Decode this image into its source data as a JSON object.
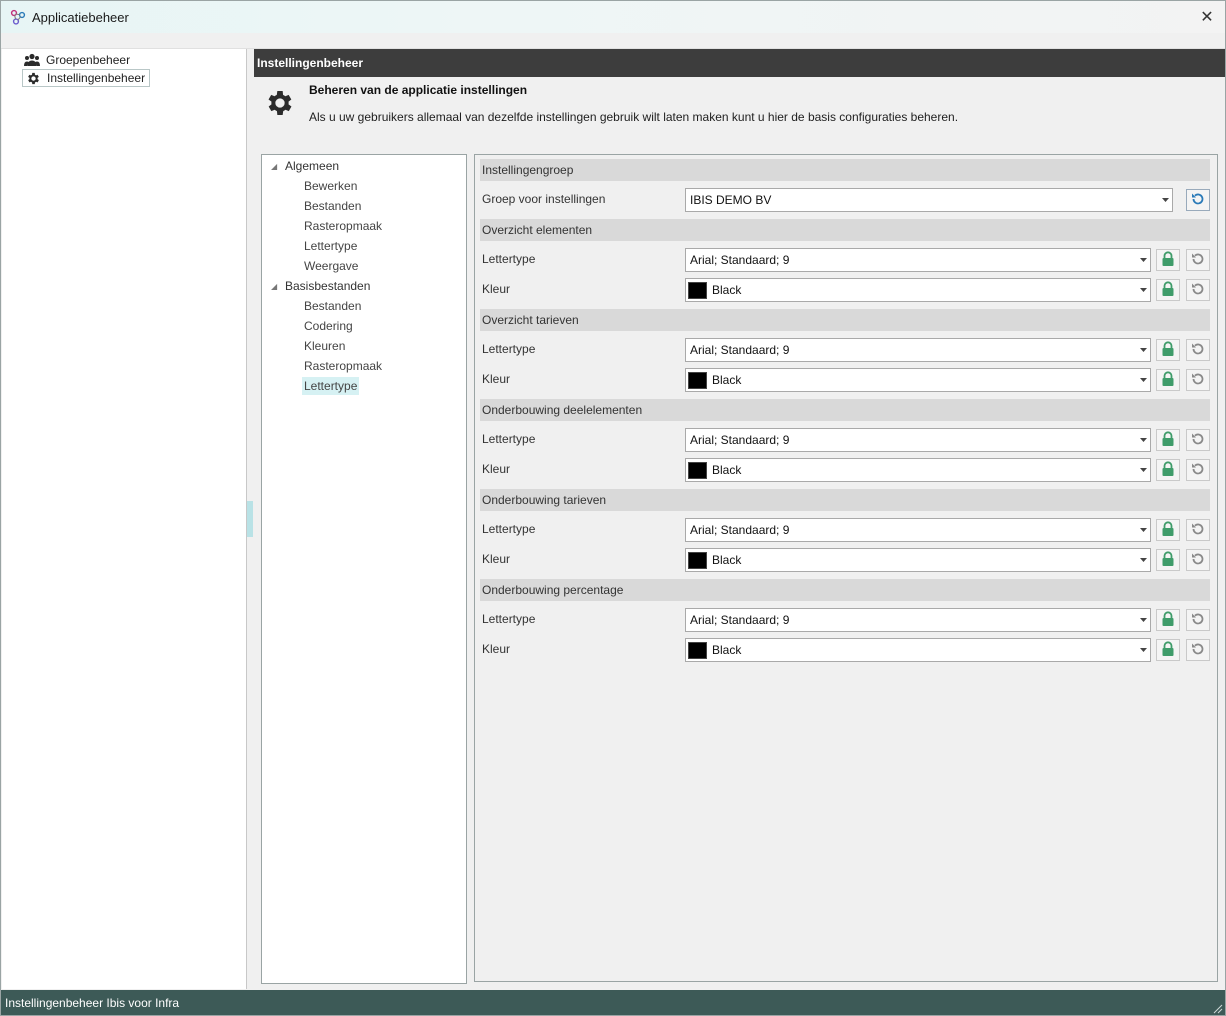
{
  "window": {
    "title": "Applicatiebeheer",
    "close_label": "✕"
  },
  "nav": {
    "items": [
      {
        "label": "Groepenbeheer",
        "icon": "users-icon"
      },
      {
        "label": "Instellingenbeheer",
        "icon": "gear-icon",
        "selected": true
      }
    ]
  },
  "panel": {
    "header": "Instellingenbeheer",
    "desc_title": "Beheren van de applicatie instellingen",
    "desc_text": "Als u uw gebruikers allemaal van dezelfde instellingen gebruik wilt laten maken kunt u hier de basis configuraties beheren."
  },
  "tree": {
    "groups": [
      {
        "label": "Algemeen",
        "children": [
          "Bewerken",
          "Bestanden",
          "Rasteropmaak",
          "Lettertype",
          "Weergave"
        ]
      },
      {
        "label": "Basisbestanden",
        "children": [
          "Bestanden",
          "Codering",
          "Kleuren",
          "Rasteropmaak",
          "Lettertype"
        ]
      }
    ],
    "selected": "Basisbestanden/Lettertype"
  },
  "settings": {
    "group_header": "Instellingengroep",
    "group_label": "Groep voor instellingen",
    "group_value": "IBIS DEMO BV",
    "sections": [
      {
        "title": "Overzicht elementen",
        "font_label": "Lettertype",
        "font_value": "Arial; Standaard; 9",
        "color_label": "Kleur",
        "color_value": "Black"
      },
      {
        "title": "Overzicht tarieven",
        "font_label": "Lettertype",
        "font_value": "Arial; Standaard; 9",
        "color_label": "Kleur",
        "color_value": "Black"
      },
      {
        "title": "Onderbouwing deelelementen",
        "font_label": "Lettertype",
        "font_value": "Arial; Standaard; 9",
        "color_label": "Kleur",
        "color_value": "Black"
      },
      {
        "title": "Onderbouwing tarieven",
        "font_label": "Lettertype",
        "font_value": "Arial; Standaard; 9",
        "color_label": "Kleur",
        "color_value": "Black"
      },
      {
        "title": "Onderbouwing percentage",
        "font_label": "Lettertype",
        "font_value": "Arial; Standaard; 9",
        "color_label": "Kleur",
        "color_value": "Black"
      }
    ]
  },
  "status": {
    "text": "Instellingenbeheer Ibis voor Infra"
  },
  "colors": {
    "header_bg": "#3d3d3d",
    "status_bg": "#3d5a57",
    "lock_green": "#3f9c6a",
    "reset_blue": "#2a7ab8",
    "selected_tree": "#d6f1f3"
  }
}
